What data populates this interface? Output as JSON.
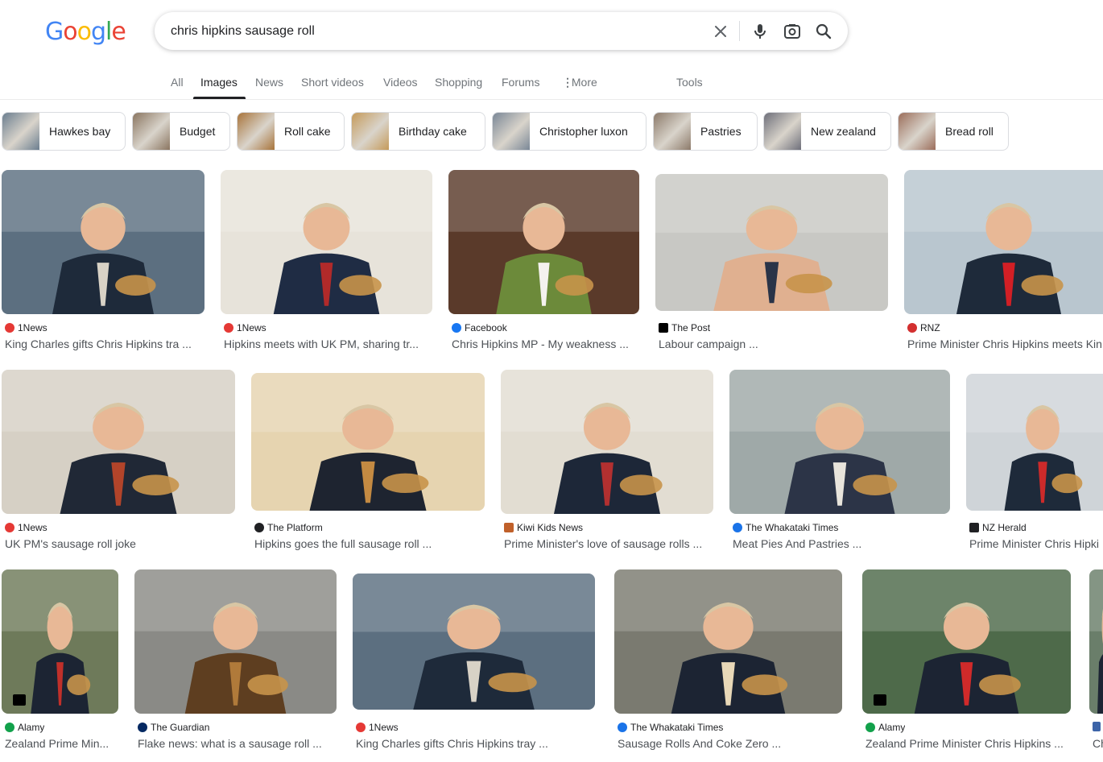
{
  "logo": {
    "text": "Google"
  },
  "search": {
    "query": "chris hipkins sausage roll",
    "clear_icon": "close-icon",
    "voice_icon": "mic-icon",
    "lens_icon": "camera-lens-icon",
    "search_icon": "search-icon"
  },
  "tabs": [
    "All",
    "Images",
    "News",
    "Short videos",
    "Videos",
    "Shopping",
    "Forums",
    "More",
    "Tools"
  ],
  "active_tab": "Images",
  "chips": [
    {
      "label": "Hawkes bay",
      "color": "#6b7e8f"
    },
    {
      "label": "Budget",
      "color": "#8a7560"
    },
    {
      "label": "Roll cake",
      "color": "#a8743a"
    },
    {
      "label": "Birthday cake",
      "color": "#c59a5a"
    },
    {
      "label": "Christopher luxon",
      "color": "#7a8796"
    },
    {
      "label": "Pastries",
      "color": "#8c7a6a"
    },
    {
      "label": "New zealand",
      "color": "#6e6f7a"
    },
    {
      "label": "Bread roll",
      "color": "#9b6d5a"
    }
  ],
  "results": [
    {
      "source": "1News",
      "title": "King Charles gifts Chris Hipkins tra ...",
      "fav_color": "#e53935",
      "img": [
        "#5c6f80",
        "#d8d2c6",
        "#1e2a3a"
      ]
    },
    {
      "source": "1News",
      "title": "Hipkins meets with UK PM, sharing tr...",
      "fav_color": "#e53935",
      "img": [
        "#e7e3da",
        "#b02a2a",
        "#1f2c44"
      ]
    },
    {
      "source": "Facebook",
      "title": "Chris Hipkins MP - My weakness ...",
      "fav_color": "#1877f2",
      "img": [
        "#5a3a2a",
        "#f4f2ee",
        "#6c8a3a"
      ]
    },
    {
      "source": "The Post",
      "title": "Labour campaign ...",
      "fav_color": "#000000",
      "img": [
        "#c8c8c4",
        "#2a3448",
        "#e0b090"
      ]
    },
    {
      "source": "RNZ",
      "title": "Prime Minister Chris Hipkins meets Kin",
      "fav_color": "#d32f2f",
      "img": [
        "#b9c6cf",
        "#d21f25",
        "#1e2a3a"
      ]
    },
    {
      "source": "1News",
      "title": "UK PM's sausage roll joke",
      "fav_color": "#e53935",
      "img": [
        "#d6d0c5",
        "#b2442a",
        "#202836"
      ]
    },
    {
      "source": "The Platform",
      "title": "Hipkins goes the full sausage roll ...",
      "fav_color": "#202124",
      "img": [
        "#e6d4b0",
        "#c48a42",
        "#1e2430"
      ]
    },
    {
      "source": "Kiwi Kids News",
      "title": "Prime Minister's love of sausage rolls ...",
      "fav_color": "#c0602a",
      "img": [
        "#e2ddd2",
        "#b23030",
        "#1d2738"
      ]
    },
    {
      "source": "The Whakataki Times",
      "title": "Meat Pies And Pastries ...",
      "fav_color": "#1a73e8",
      "img": [
        "#9fa9a8",
        "#e8e4dc",
        "#2c3447"
      ]
    },
    {
      "source": "NZ Herald",
      "title": "Prime Minister Chris Hipki",
      "fav_color": "#202124",
      "img": [
        "#cfd4d8",
        "#cc2a2a",
        "#1e2a3a"
      ]
    },
    {
      "source": "Alamy",
      "title": "Zealand Prime Min...",
      "fav_color": "#12a14b",
      "img": [
        "#6e7a5a",
        "#c0302a",
        "#1c2433"
      ]
    },
    {
      "source": "The Guardian",
      "title": "Flake news: what is a sausage roll ...",
      "fav_color": "#052962",
      "img": [
        "#8a8a86",
        "#b07a3a",
        "#5e3e20"
      ]
    },
    {
      "source": "1News",
      "title": "King Charles gifts Chris Hipkins tray ...",
      "fav_color": "#e53935",
      "img": [
        "#5c6f80",
        "#d8d2c6",
        "#1e2a3a"
      ]
    },
    {
      "source": "The Whakataki Times",
      "title": "Sausage Rolls And Coke Zero ...",
      "fav_color": "#1a73e8",
      "img": [
        "#7a7a70",
        "#e8d8b8",
        "#1c2433"
      ]
    },
    {
      "source": "Alamy",
      "title": "Zealand Prime Minister Chris Hipkins ...",
      "fav_color": "#12a14b",
      "img": [
        "#4e6a4a",
        "#d02a2a",
        "#1c2433"
      ]
    },
    {
      "source": "",
      "title": "Ch",
      "fav_color": "#3c64a8",
      "img": [
        "#6a7e6a",
        "#2c3a2c",
        "#1c2433"
      ]
    }
  ]
}
